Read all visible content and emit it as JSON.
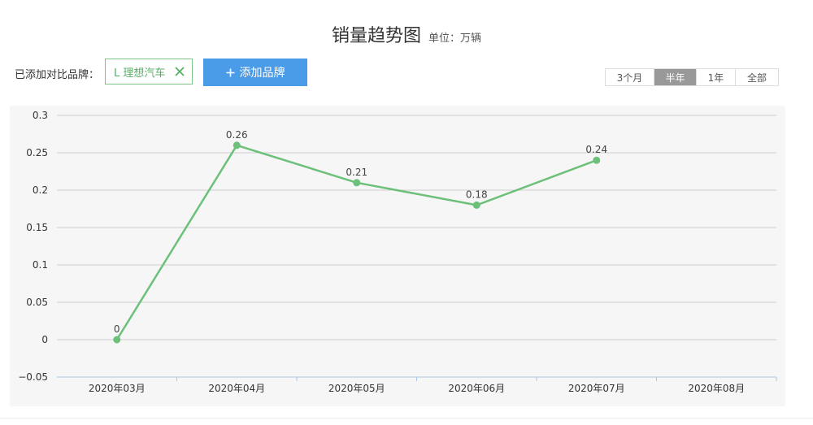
{
  "header": {
    "title": "销量趋势图",
    "unit": "单位：万辆"
  },
  "compare": {
    "label": "已添加对比品牌：",
    "brand_tag": "L 理想汽车",
    "add_button": "添加品牌",
    "add_button_icon": "plus-icon"
  },
  "range_tabs": [
    {
      "label": "3个月",
      "active": false
    },
    {
      "label": "半年",
      "active": true
    },
    {
      "label": "1年",
      "active": false
    },
    {
      "label": "全部",
      "active": false
    }
  ],
  "colors": {
    "series": "#6cc07a",
    "accent_button": "#4a9be8",
    "tag_border": "#7cc68a",
    "active_tab": "#999999"
  },
  "chart_data": {
    "type": "line",
    "title": "销量趋势图",
    "unit": "单位：万辆",
    "categories": [
      "2020年03月",
      "2020年04月",
      "2020年05月",
      "2020年06月",
      "2020年07月",
      "2020年08月"
    ],
    "series": [
      {
        "name": "理想汽车",
        "values": [
          0,
          0.26,
          0.21,
          0.18,
          0.24,
          null
        ],
        "data_labels": [
          "0",
          "0.26",
          "0.21",
          "0.18",
          "0.24",
          ""
        ]
      }
    ],
    "yticks": [
      0.3,
      0.25,
      0.2,
      0.15,
      0.1,
      0.05,
      0,
      -0.05
    ],
    "ytick_labels": [
      "0.3",
      "0.25",
      "0.2",
      "0.15",
      "0.1",
      "0.05",
      "0",
      "−0.05"
    ],
    "ylim": [
      -0.05,
      0.3
    ],
    "grid": true,
    "legend": "none"
  }
}
